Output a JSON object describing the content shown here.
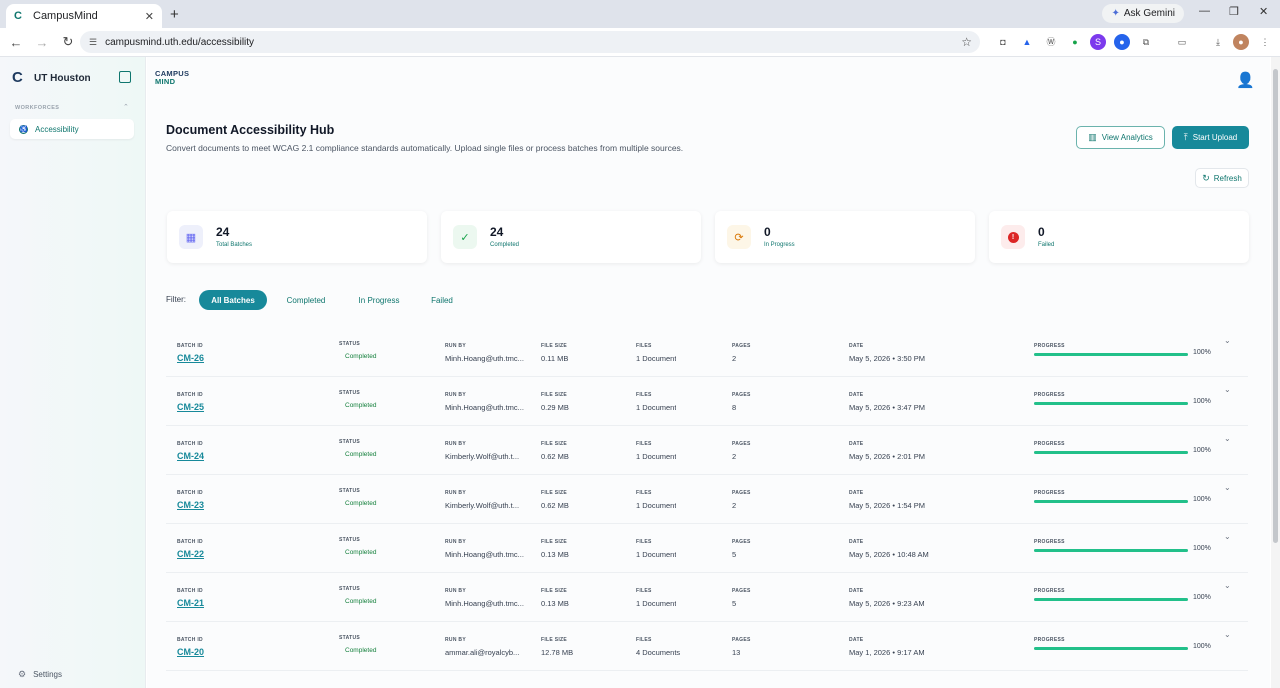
{
  "browser": {
    "tab_title": "CampusMind",
    "url": "campusmind.uth.edu/accessibility",
    "gemini_label": "Ask Gemini"
  },
  "sidebar": {
    "org_name": "UT Houston",
    "section_label": "WORKFORCES",
    "items": [
      {
        "label": "Accessibility"
      }
    ],
    "settings_label": "Settings"
  },
  "brand": {
    "line1": "CAMPUS",
    "line2": "MIND"
  },
  "page": {
    "title": "Document Accessibility Hub",
    "subtitle": "Convert documents to meet WCAG 2.1 compliance standards automatically. Upload single files or process batches from multiple sources.",
    "view_analytics": "View Analytics",
    "start_upload": "Start Upload",
    "refresh": "Refresh"
  },
  "stats": [
    {
      "value": "24",
      "label": "Total Batches",
      "icon": "grid-icon",
      "color": "#6366f1"
    },
    {
      "value": "24",
      "label": "Completed",
      "icon": "check-icon",
      "color": "#16a34a"
    },
    {
      "value": "0",
      "label": "In Progress",
      "icon": "sync-icon",
      "color": "#d97706"
    },
    {
      "value": "0",
      "label": "Failed",
      "icon": "alert-icon",
      "color": "#dc2626"
    }
  ],
  "filter": {
    "label": "Filter:",
    "options": [
      "All Batches",
      "Completed",
      "In Progress",
      "Failed"
    ],
    "active": "All Batches"
  },
  "columns": {
    "batch_id": "BATCH ID",
    "status": "STATUS",
    "run_by": "RUN BY",
    "file_size": "FILE SIZE",
    "files": "FILES",
    "pages": "PAGES",
    "date": "DATE",
    "progress": "PROGRESS"
  },
  "batches": [
    {
      "id": "CM-26",
      "status": "Completed",
      "run_by": "Minh.Hoang@uth.tmc...",
      "file_size": "0.11 MB",
      "files": "1 Document",
      "pages": "2",
      "date": "May 5, 2026 • 3:50 PM",
      "progress": 100,
      "progress_label": "100%"
    },
    {
      "id": "CM-25",
      "status": "Completed",
      "run_by": "Minh.Hoang@uth.tmc...",
      "file_size": "0.29 MB",
      "files": "1 Document",
      "pages": "8",
      "date": "May 5, 2026 • 3:47 PM",
      "progress": 100,
      "progress_label": "100%"
    },
    {
      "id": "CM-24",
      "status": "Completed",
      "run_by": "Kimberly.Wolf@uth.t...",
      "file_size": "0.62 MB",
      "files": "1 Document",
      "pages": "2",
      "date": "May 5, 2026 • 2:01 PM",
      "progress": 100,
      "progress_label": "100%"
    },
    {
      "id": "CM-23",
      "status": "Completed",
      "run_by": "Kimberly.Wolf@uth.t...",
      "file_size": "0.62 MB",
      "files": "1 Document",
      "pages": "2",
      "date": "May 5, 2026 • 1:54 PM",
      "progress": 100,
      "progress_label": "100%"
    },
    {
      "id": "CM-22",
      "status": "Completed",
      "run_by": "Minh.Hoang@uth.tmc...",
      "file_size": "0.13 MB",
      "files": "1 Document",
      "pages": "5",
      "date": "May 5, 2026 • 10:48 AM",
      "progress": 100,
      "progress_label": "100%"
    },
    {
      "id": "CM-21",
      "status": "Completed",
      "run_by": "Minh.Hoang@uth.tmc...",
      "file_size": "0.13 MB",
      "files": "1 Document",
      "pages": "5",
      "date": "May 5, 2026 • 9:23 AM",
      "progress": 100,
      "progress_label": "100%"
    },
    {
      "id": "CM-20",
      "status": "Completed",
      "run_by": "ammar.ali@royalcyb...",
      "file_size": "12.78 MB",
      "files": "4 Documents",
      "pages": "13",
      "date": "May 1, 2026 • 9:17 AM",
      "progress": 100,
      "progress_label": "100%"
    }
  ]
}
